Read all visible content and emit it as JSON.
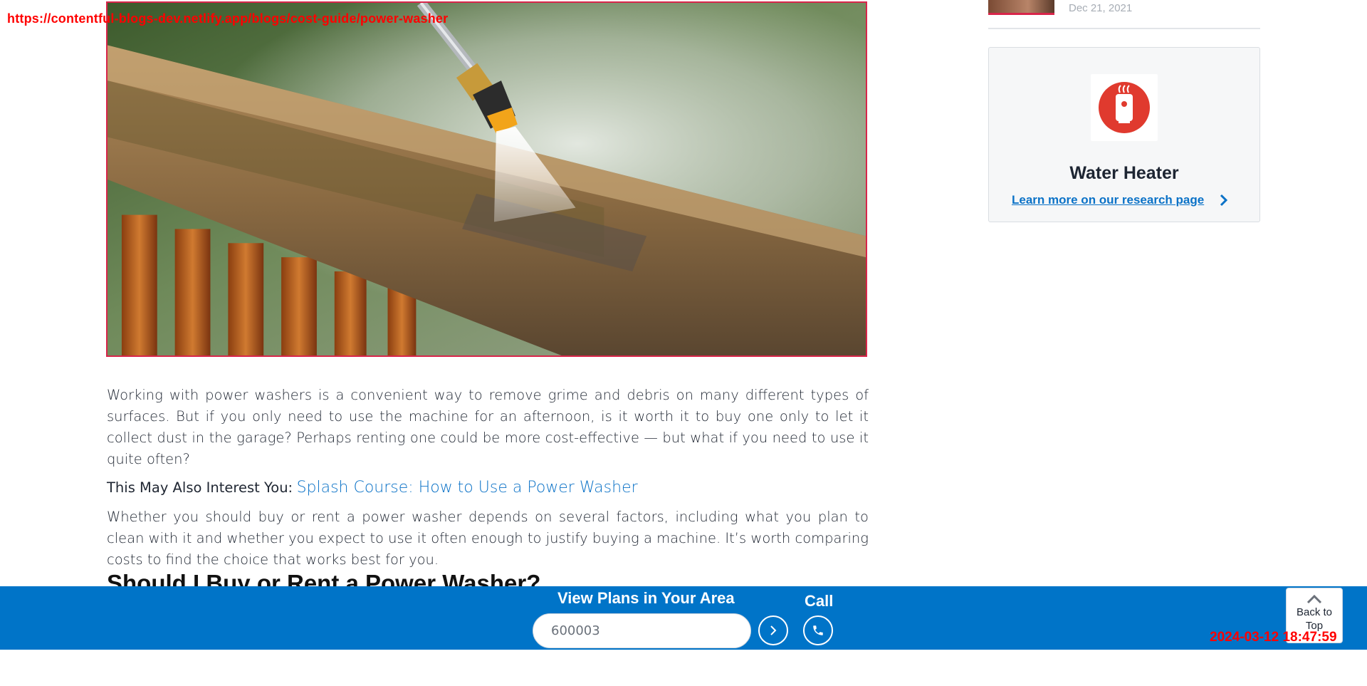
{
  "overlay": {
    "url": "https://contentful-blogs-dev.netlify.app/blogs/cost-guide/power-washer",
    "timestamp": "2024-03-12 18:47:59"
  },
  "hero": {
    "image": "pressure-washer-cleaning-wooden-railing"
  },
  "article": {
    "paragraph1": "Working with power washers is a convenient way to remove grime and debris on many different types of surfaces. But if you only need to use the machine for an afternoon, is it worth it to buy one only to let it collect dust in the garage? Perhaps renting one could be more cost-effective — but what if you need to use it quite often?",
    "interest_label": "This May Also Interest You:",
    "interest_link": "Splash Course: How to Use a Power Washer",
    "paragraph2": "Whether you should buy or rent a power washer depends on several factors, including what you plan to clean with it and whether you expect to use it often enough to justify buying a machine. It’s worth comparing costs to find the choice that works best for you.",
    "heading": "Should I Buy or Rent a Power Washer?"
  },
  "sidebar": {
    "recent_date": "Dec 21, 2021",
    "card": {
      "icon": "water-heater-icon",
      "title": "Water Heater",
      "link": "Learn more on our research page"
    }
  },
  "sticky_bar": {
    "title": "View Plans in Your Area",
    "zip_value": "600003",
    "call_label": "Call",
    "back_to_top": "Back to Top"
  },
  "colors": {
    "brand_blue": "#0074c8",
    "link_blue": "#0b72c7",
    "accent_red": "#e03a2e",
    "hero_border": "#d8254a"
  }
}
